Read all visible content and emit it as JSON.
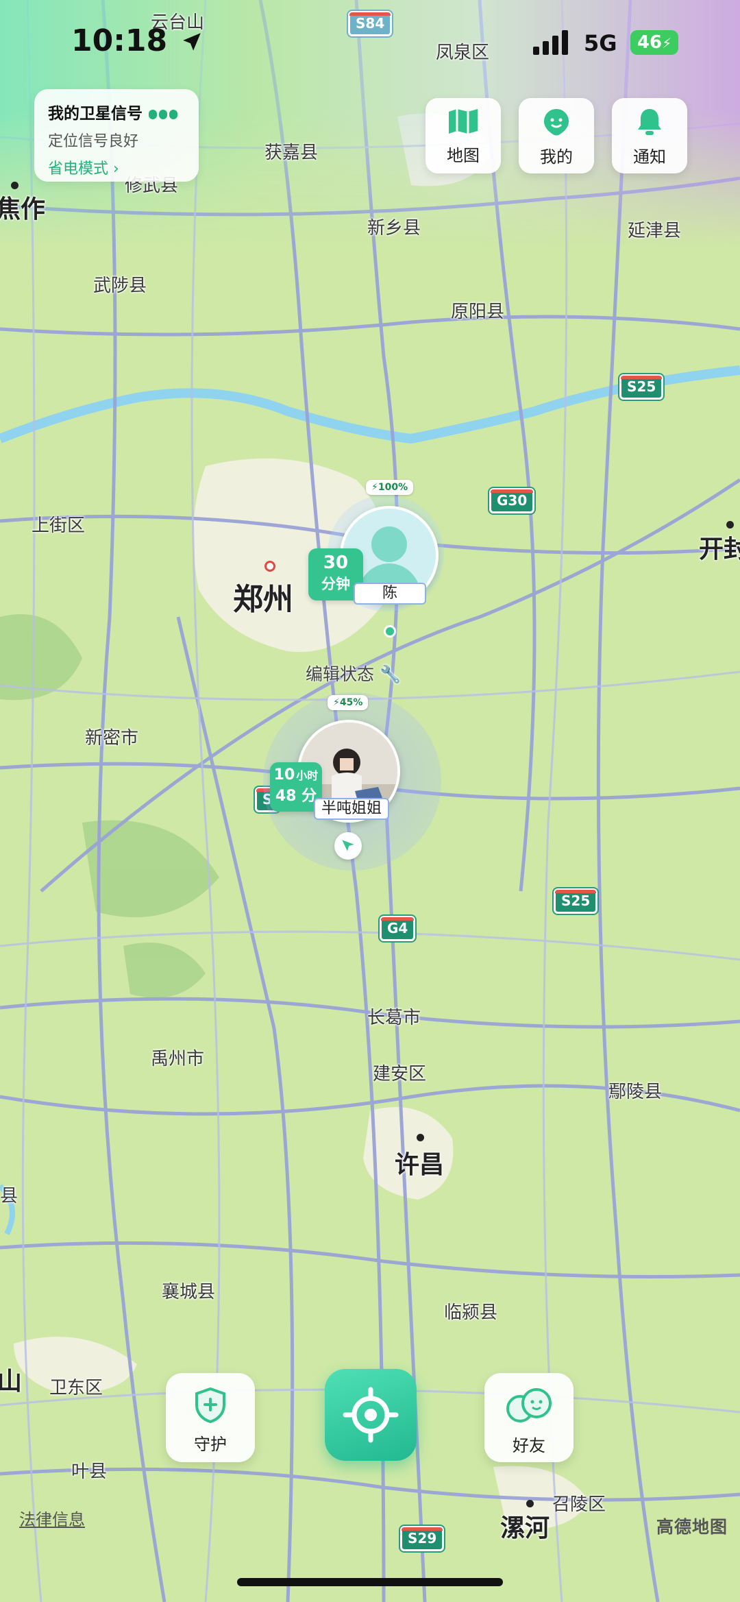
{
  "status_bar": {
    "time": "10:18",
    "network": "5G",
    "battery": "46"
  },
  "signal_card": {
    "title": "我的卫星信号",
    "status": "定位信号良好",
    "link": "省电模式"
  },
  "top_actions": [
    {
      "label": "地图",
      "icon": "map-icon"
    },
    {
      "label": "我的",
      "icon": "face-icon"
    },
    {
      "label": "通知",
      "icon": "bell-icon"
    }
  ],
  "map_labels": {
    "yuntaishan": "云台山",
    "fengquan": "凤泉区",
    "huojia": "获嘉县",
    "xiuwu": "修武县",
    "jiaozuo": "焦作",
    "xinxiang": "新乡县",
    "yanjin": "延津县",
    "wuzhi": "武陟县",
    "yuanyang": "原阳县",
    "shangjie": "上街区",
    "zhengzhou": "郑州",
    "kaifeng": "开封",
    "xinmi": "新密市",
    "changge": "长葛市",
    "yuzhou": "禹州市",
    "jianan": "建安区",
    "yanling": "鄢陵县",
    "xuchang": "许昌",
    "xiangcheng": "襄城县",
    "linying": "临颍县",
    "weidong": "卫东区",
    "ye": "叶县",
    "zhaoling": "召陵区",
    "luohe": "漯河",
    "shan": "山",
    "xian_partial": "县"
  },
  "road_shields": [
    "S84",
    "S25",
    "G30",
    "G4",
    "S25",
    "S29",
    "S"
  ],
  "friends": [
    {
      "name": "陈",
      "time_top": "30",
      "time_bottom": "分钟",
      "battery": "100%"
    },
    {
      "name": "半吨姐姐",
      "time_top_num": "10",
      "time_top_unit": "小时",
      "time_bottom": "48 分",
      "battery": "45%"
    }
  ],
  "edit_status": "编辑状态",
  "bottom_actions": {
    "guard": "守护",
    "friends": "好友"
  },
  "footer": {
    "legal": "法律信息",
    "logo": "高德地图"
  },
  "colors": {
    "accent": "#22b07d",
    "map_bg": "#cfe8a6",
    "road": "#9aa3d6"
  }
}
